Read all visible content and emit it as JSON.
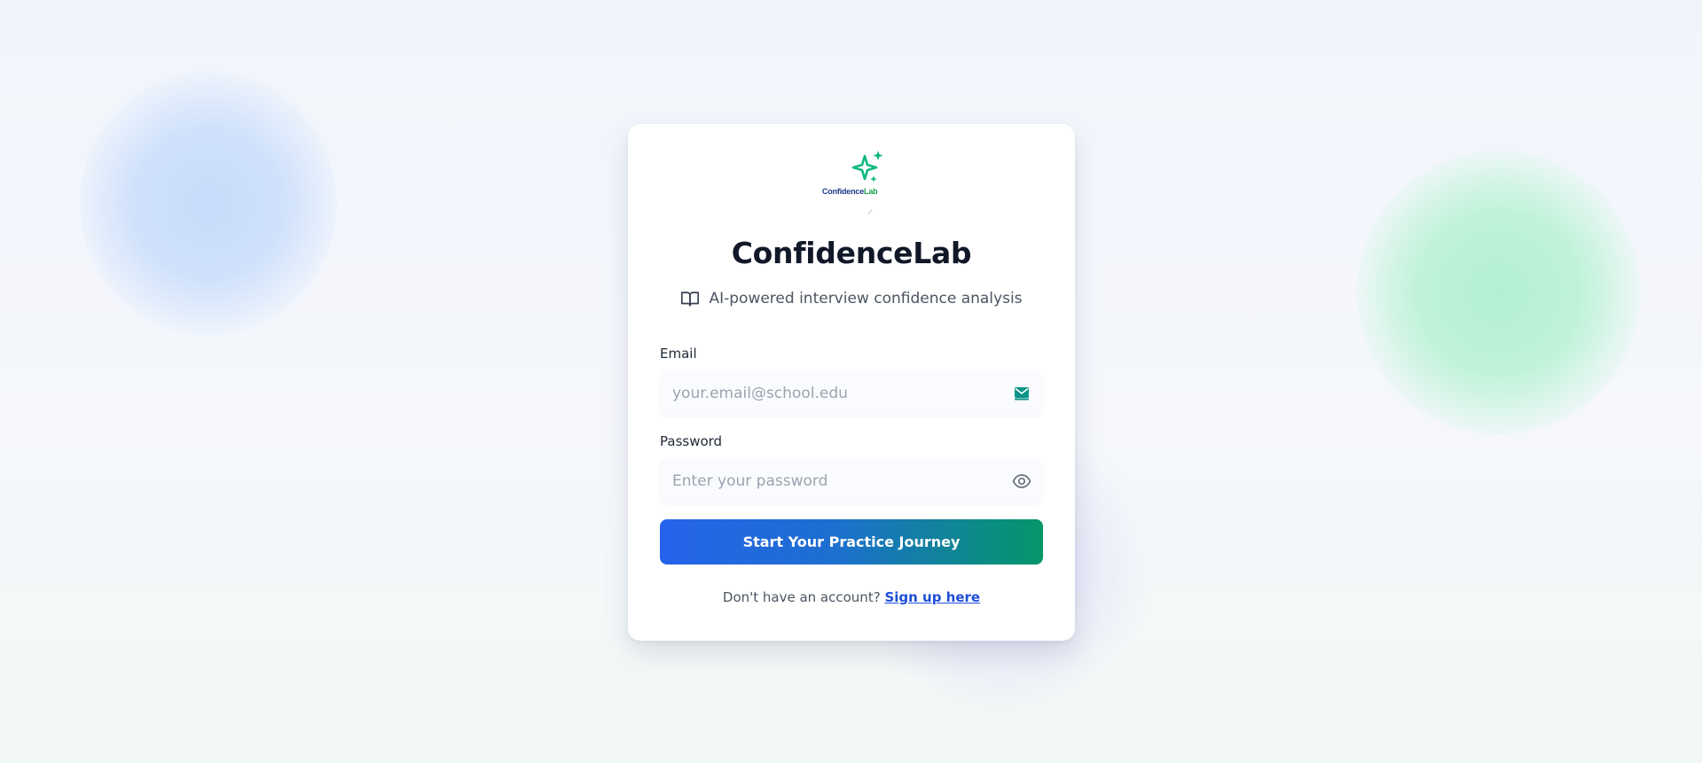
{
  "brand": {
    "logo_text_main": "Confidence",
    "logo_text_accent": "Lab",
    "title": "ConfidenceLab",
    "subtitle": "AI-powered interview confidence analysis"
  },
  "form": {
    "email_label": "Email",
    "email_placeholder": "your.email@school.edu",
    "email_value": "",
    "password_label": "Password",
    "password_placeholder": "Enter your password",
    "password_value": "",
    "submit_label": "Start Your Practice Journey"
  },
  "footer": {
    "prompt": "Don't have an account?",
    "signup_link": "Sign up here"
  },
  "icons": {
    "logo": "sparkles-icon",
    "subtitle": "book-open-icon",
    "email": "mail-icon",
    "password": "eye-icon"
  },
  "colors": {
    "primary_blue": "#2563eb",
    "accent_green": "#059669",
    "sparkle_green": "#10b981",
    "title_text": "#111827",
    "link": "#1d4ed8"
  }
}
